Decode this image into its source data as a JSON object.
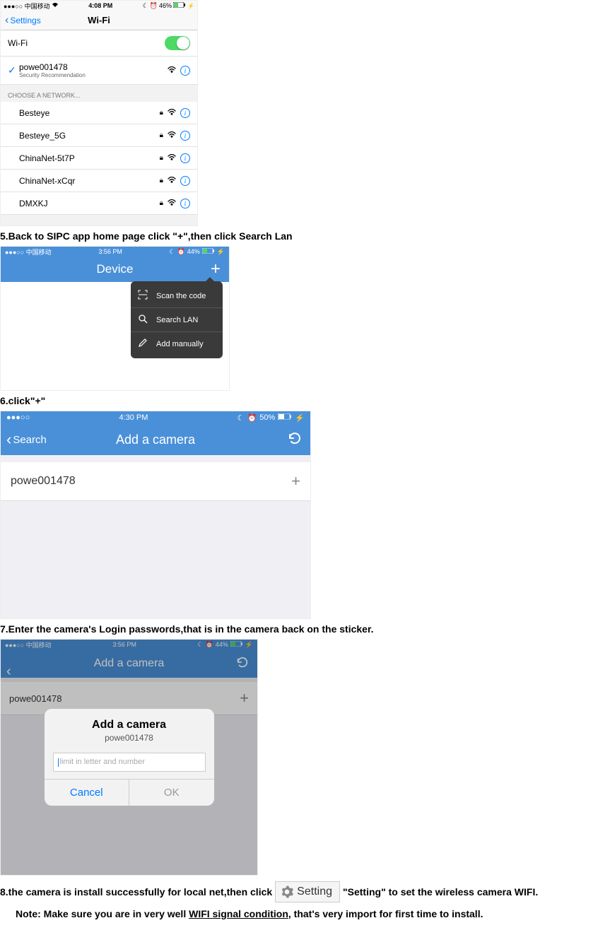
{
  "shot1": {
    "status": {
      "carrier": "●●●○○ 中国移动",
      "time": "4:08 PM",
      "battery": "46%"
    },
    "back": "Settings",
    "title": "Wi-Fi",
    "wifi_label": "Wi-Fi",
    "connected": {
      "name": "powe001478",
      "sub": "Security Recommendation"
    },
    "choose_label": "CHOOSE A NETWORK...",
    "networks": [
      "Besteye",
      "Besteye_5G",
      "ChinaNet-5t7P",
      "ChinaNet-xCqr",
      "DMXKJ"
    ]
  },
  "step5": "5.Back to SIPC app home page click \"+\",then click Search Lan",
  "shot2": {
    "status": {
      "carrier": "●●●○○ 中国移动",
      "time": "3:56 PM",
      "battery": "44%"
    },
    "title": "Device",
    "menu": {
      "scan": "Scan the code",
      "search": "Search LAN",
      "add": "Add manually"
    }
  },
  "step6": "6.click\"+\"",
  "shot3": {
    "status": {
      "carrier_dots": "●●●○○",
      "time": "4:30 PM",
      "battery": "50%"
    },
    "back": "Search",
    "title": "Add a camera",
    "item": "powe001478"
  },
  "step7": "7.Enter the camera's Login passwords,that is in the camera back on the sticker.",
  "shot4": {
    "status": {
      "carrier": "●●●○○ 中国移动",
      "time": "3:56 PM",
      "battery": "44%"
    },
    "title": "Add a camera",
    "item": "powe001478",
    "dialog": {
      "title": "Add a camera",
      "sub": "powe001478",
      "placeholder": "limit in letter and number",
      "cancel": "Cancel",
      "ok": "OK"
    }
  },
  "step8": {
    "p1": "8.the camera is install successfully for local net,then click",
    "setting": "Setting",
    "p2": "\"Setting\" to set the wireless camera WIFI."
  },
  "note": {
    "p1": "Note: Make sure you are in very well ",
    "ul": "WIFI signal condition",
    "p2": ", that's very import for first time to install."
  }
}
